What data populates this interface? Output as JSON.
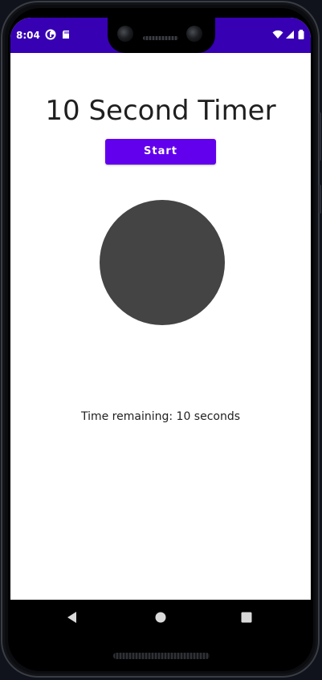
{
  "status_bar": {
    "time": "8:04",
    "left_icons": [
      "data-saver-icon",
      "sd-card-icon"
    ],
    "right_icons": [
      "wifi-icon",
      "cell-signal-icon",
      "battery-icon"
    ],
    "background_color": "#3700b3"
  },
  "app": {
    "title": "10 Second Timer",
    "start_label": "Start",
    "accent_color": "#6200ee",
    "circle_color": "#444444",
    "time_remaining": "Time remaining: 10 seconds"
  },
  "nav_bar": {
    "buttons": [
      "back-icon",
      "home-icon",
      "recents-icon"
    ]
  }
}
